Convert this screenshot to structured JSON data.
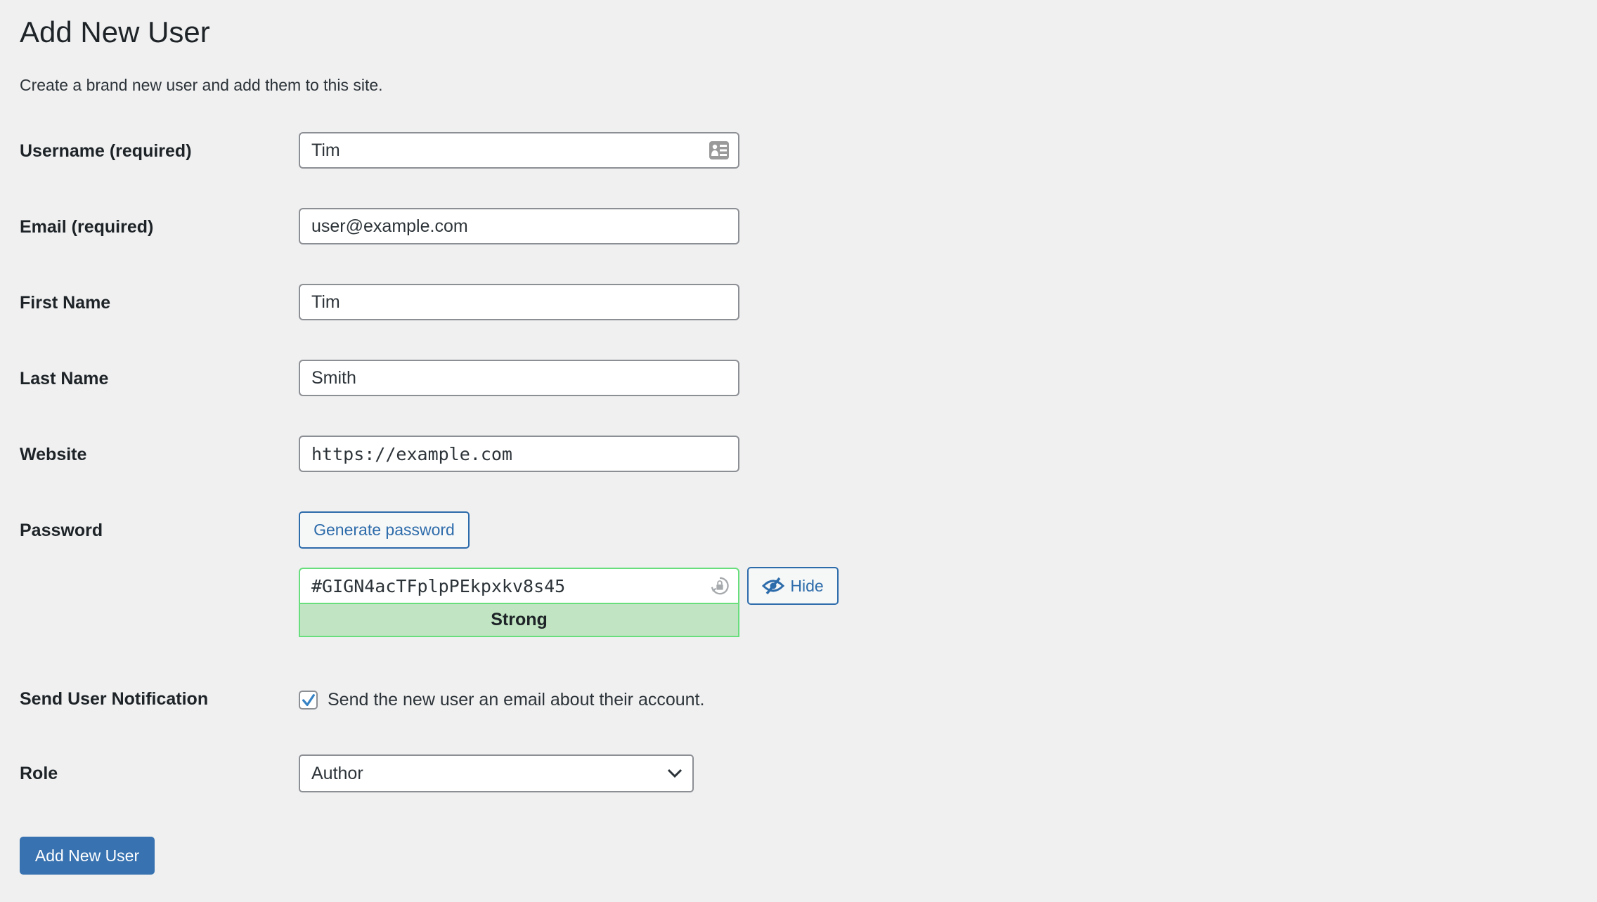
{
  "page": {
    "title": "Add New User",
    "description": "Create a brand new user and add them to this site."
  },
  "fields": {
    "username": {
      "label": "Username (required)",
      "value": "Tim",
      "icon": "contact-card-icon"
    },
    "email": {
      "label": "Email (required)",
      "value": "user@example.com"
    },
    "first_name": {
      "label": "First Name",
      "value": "Tim"
    },
    "last_name": {
      "label": "Last Name",
      "value": "Smith"
    },
    "website": {
      "label": "Website",
      "value": "https://example.com"
    }
  },
  "password": {
    "label": "Password",
    "generate_label": "Generate password",
    "value": "#GIGN4acTFplpPEkpxkv8s45",
    "field_icon": "password-lock-icon",
    "hide_label": "Hide",
    "hide_icon": "eye-slash-icon",
    "strength": "Strong",
    "strength_color": "#c1e5c2"
  },
  "notification": {
    "label": "Send User Notification",
    "checkbox_label": "Send the new user an email about their account.",
    "checked": true
  },
  "role": {
    "label": "Role",
    "selected": "Author"
  },
  "submit": {
    "label": "Add New User",
    "color": "#3872b0"
  }
}
